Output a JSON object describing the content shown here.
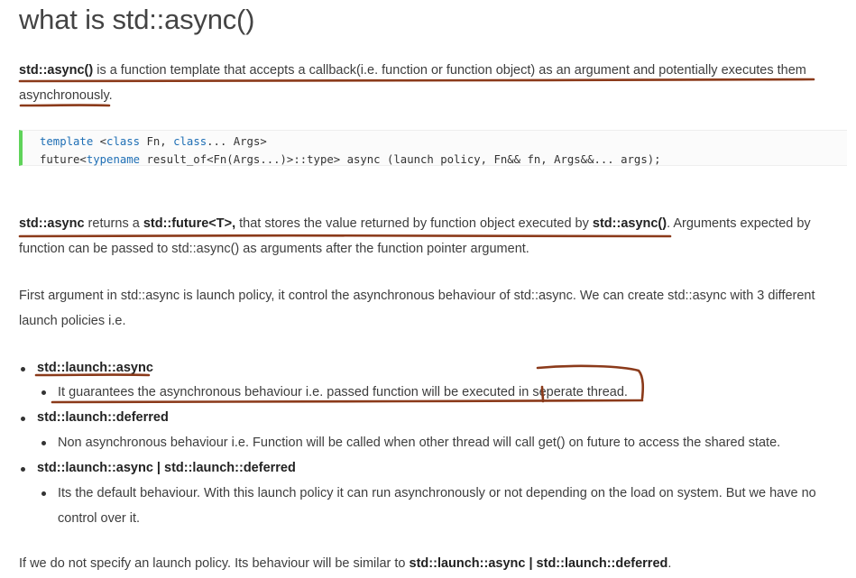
{
  "title": "what is std::async()",
  "intro": {
    "b1": "std::async()",
    "t1": " is a function template that accepts a callback(i.e. function or function object) as an argument and potentially executes them",
    "t2": "asynchronously."
  },
  "code": {
    "line1": {
      "kw1": "template",
      "p1": " <",
      "kw2": "class",
      "p2": " Fn, ",
      "kw3": "class",
      "p3": "... Args>"
    },
    "line2": {
      "p1": "future<",
      "kw1": "typename",
      "p2": " result_of<Fn(Args...)>::type> async (launch policy, Fn&& fn, Args&&... args);"
    }
  },
  "para2": {
    "b1": "std::async",
    "t1": " returns a ",
    "b2": "std::future<T>,",
    "t2": " that stores the value returned by function object executed by ",
    "b3": "std::async()",
    "t3": ". Arguments expected by",
    "t4": "function can be passed to std::async() as arguments after the function pointer argument."
  },
  "para3": {
    "l1": "First argument in std::async is launch policy, it control the asynchronous behaviour of std::async. We can create std::async with 3 different",
    "l2": "launch policies i.e."
  },
  "list": [
    {
      "label": "std::launch::async",
      "desc": "It guarantees the asynchronous behaviour i.e. passed function will be executed in seperate thread."
    },
    {
      "label": "std::launch::deferred",
      "desc": "Non asynchronous behaviour i.e. Function will be called when other thread will call get() on future to access the shared state."
    },
    {
      "label": "std::launch::async | std::launch::deferred",
      "desc1": "Its the default behaviour. With this launch policy it can run asynchronously or not depending on the load on system. But we have no",
      "desc2": "control over it."
    }
  ],
  "footer": {
    "t1": "If we do not specify an launch policy. Its behaviour will be similar to ",
    "b1": "std::launch::async | std::launch::deferred",
    "t2": "."
  },
  "colors": {
    "annotation": "#8b3a1a",
    "code_border": "#5fd35a",
    "keyword": "#1f6fb5"
  }
}
